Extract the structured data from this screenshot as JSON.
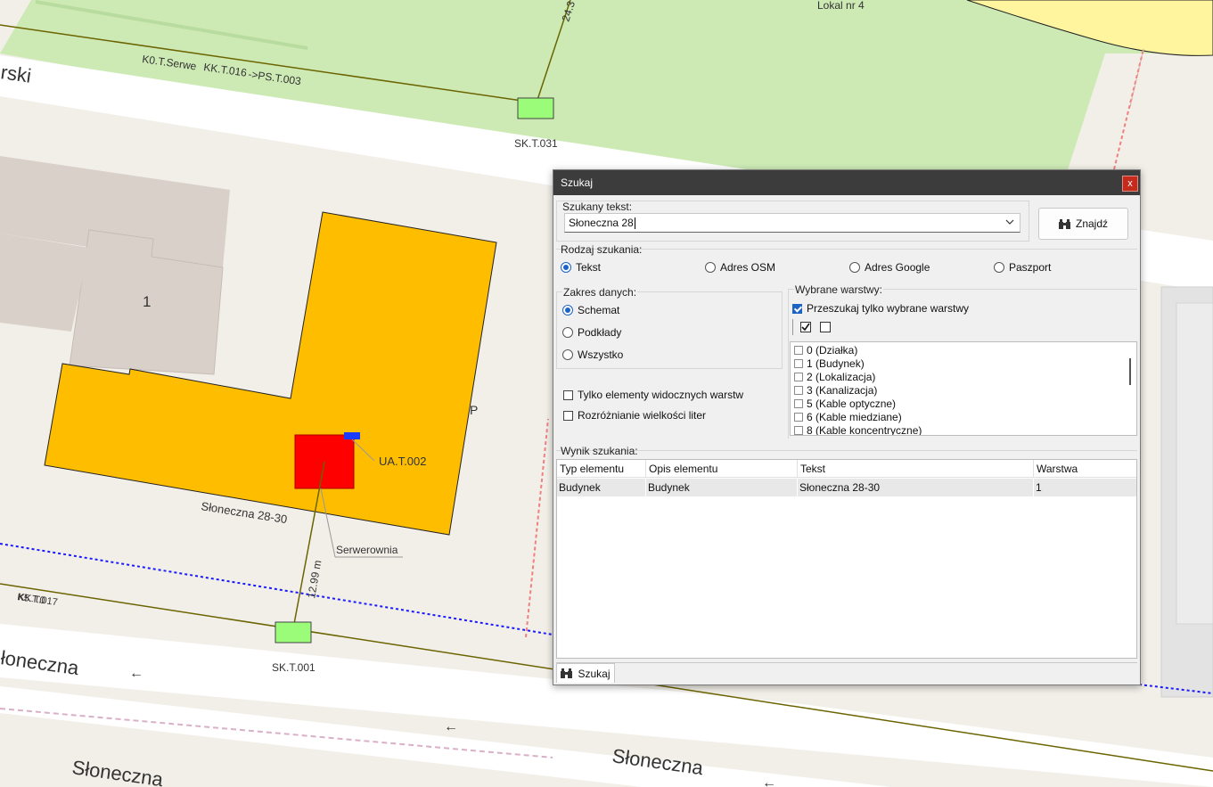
{
  "map": {
    "street_top": "rski",
    "street_bottom_left": "łoneczna",
    "street_bottom_center": "Słoneczna",
    "street_bottom_far": "Słoneczna",
    "cable_label_top": "K0.T.Serwe",
    "cable_label_top_overlap": "KK.T.016",
    "cable_label_top_tail": "->PS.T.003",
    "lokal_label": "Lokal nr 4",
    "dist_top": "24.3",
    "node_top": "SK.T.031",
    "node_bottom": "SK.T.001",
    "building_number": "1",
    "building_address": "Słoneczna 28-30",
    "device_label": "UA.T.002",
    "room_label": "Serwerownia",
    "dist_bottom": "12.99 m",
    "cable_label_left": "KK.T.017",
    "cable_label_left_overlap": "K5.T.0",
    "parking_letter": "P",
    "colors": {
      "building": "#ffbd00",
      "green_area": "#cdeab5",
      "yellow_area": "#fff59e",
      "device": "#ff0000",
      "node": "#9afc78",
      "cable": "#6b6400",
      "blue_line": "#1a1aff"
    }
  },
  "dialog": {
    "title": "Szukaj",
    "close_label": "x",
    "search_label": "Szukany tekst:",
    "search_value": "Słoneczna 28",
    "find_label": "Znajdź",
    "search_type_label": "Rodzaj szukania:",
    "search_types": [
      "Tekst",
      "Adres OSM",
      "Adres Google",
      "Paszport"
    ],
    "data_scope_label": "Zakres danych:",
    "data_scopes": [
      "Schemat",
      "Podkłady",
      "Wszystko"
    ],
    "visible_only_label": "Tylko elementy widocznych warstw",
    "case_sensitive_label": "Rozróżnianie wielkości liter",
    "layers_label": "Wybrane warstwy:",
    "layers_only_label": "Przeszukaj tylko wybrane warstwy",
    "layers": [
      "0 (Działka)",
      "1 (Budynek)",
      "2 (Lokalizacja)",
      "3 (Kanalizacja)",
      "5 (Kable optyczne)",
      "6 (Kable miedziane)",
      "8 (Kable koncentryczne)"
    ],
    "results_label": "Wynik szukania:",
    "columns": [
      "Typ elementu",
      "Opis elementu",
      "Tekst",
      "Warstwa"
    ],
    "rows": [
      [
        "Budynek",
        "Budynek",
        "Słoneczna 28-30",
        "1"
      ]
    ],
    "bottom_tab": "Szukaj"
  }
}
